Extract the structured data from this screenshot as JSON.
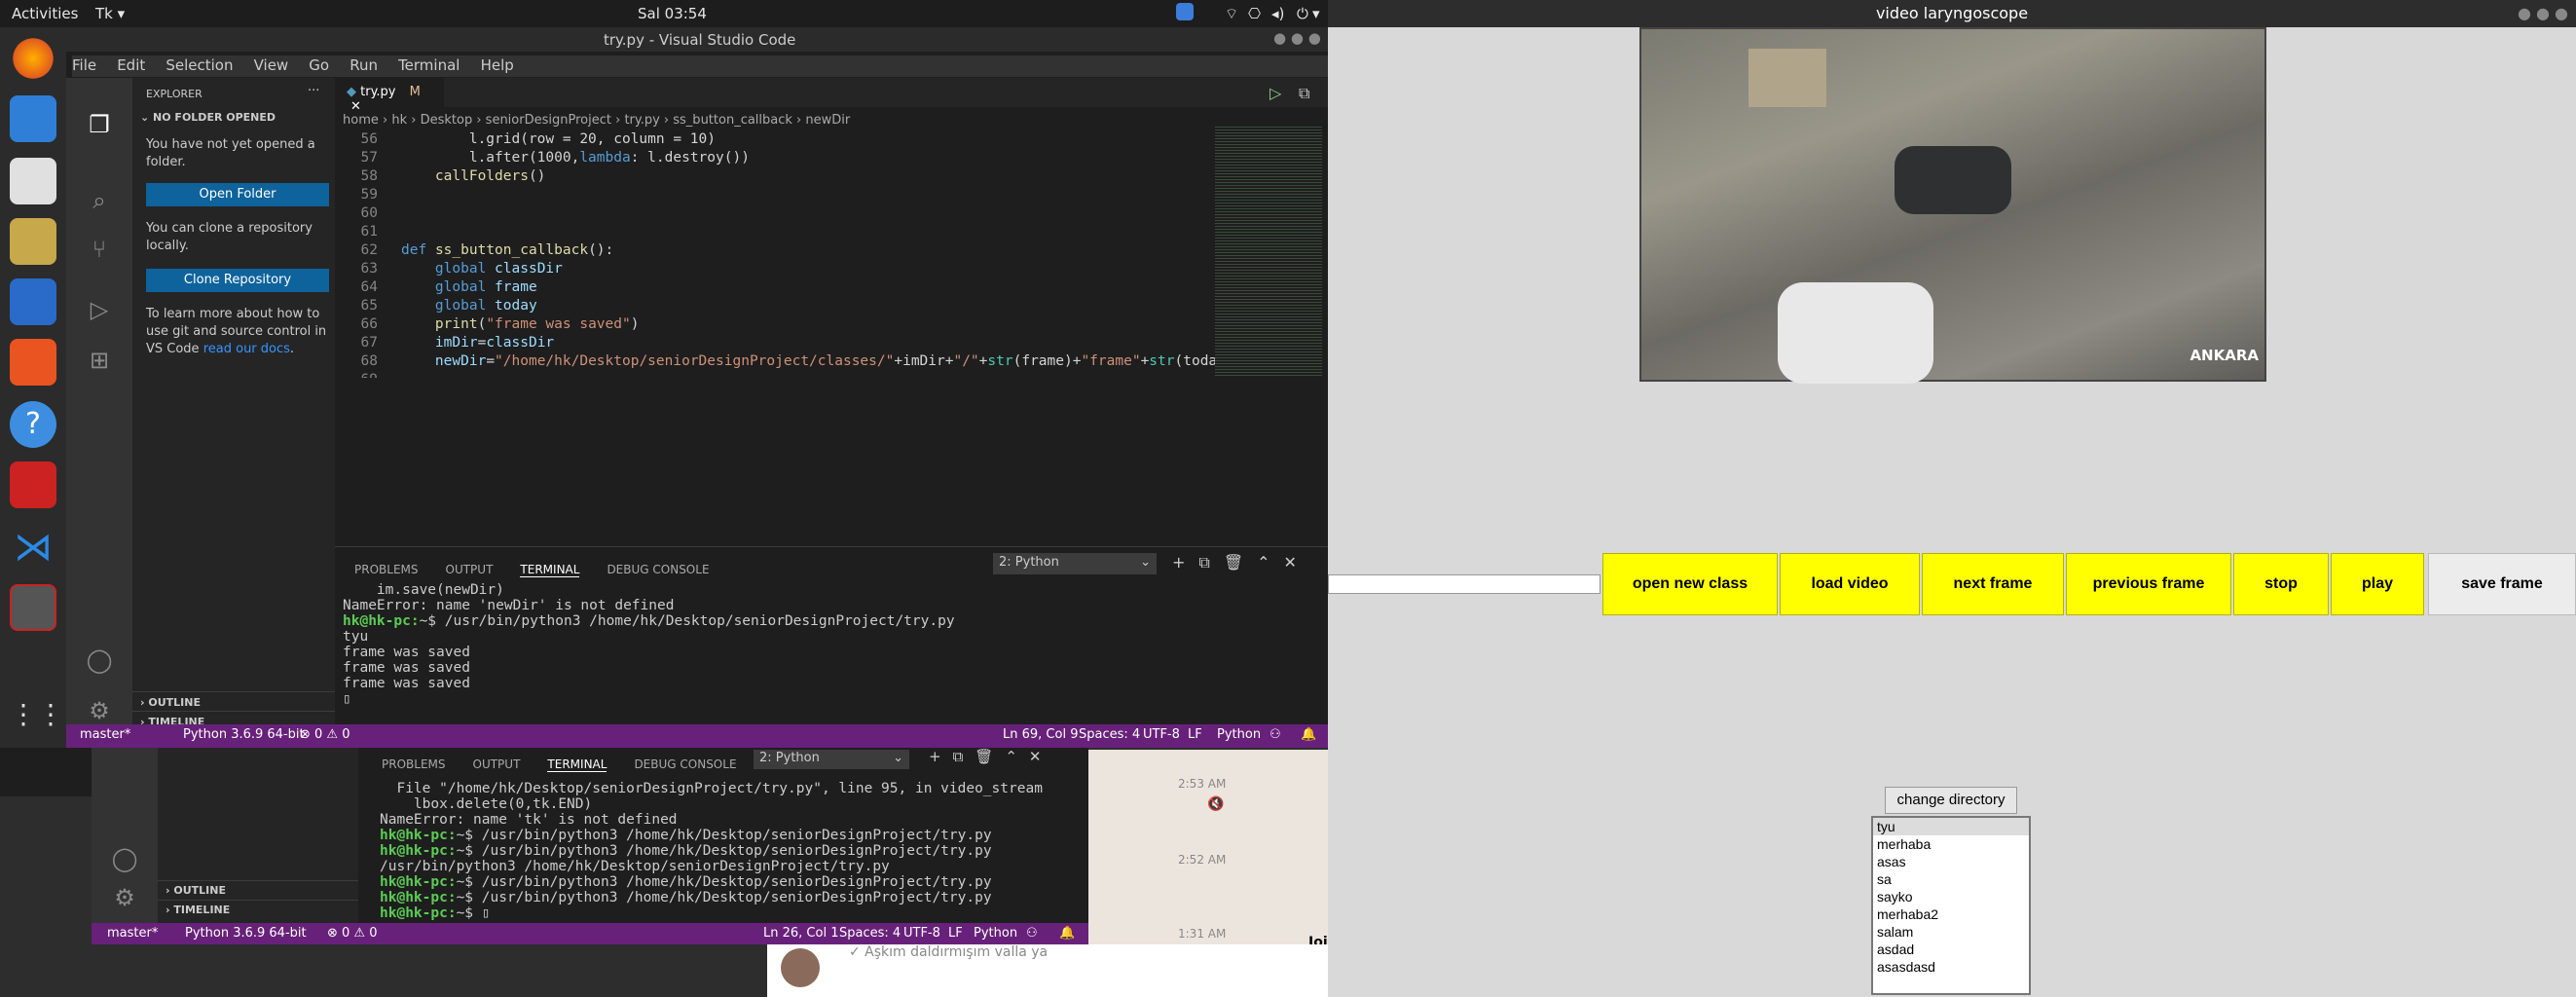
{
  "topbar": {
    "activities": "Activities",
    "app": "Tk ▾",
    "clock": "Sal 03:54"
  },
  "vscode": {
    "title": "try.py - Visual Studio Code",
    "menu": [
      "File",
      "Edit",
      "Selection",
      "View",
      "Go",
      "Run",
      "Terminal",
      "Help"
    ],
    "explorer": {
      "header": "EXPLORER",
      "section": "NO FOLDER OPENED",
      "msg1": "You have not yet opened a folder.",
      "open_btn": "Open Folder",
      "msg2": "You can clone a repository locally.",
      "clone_btn": "Clone Repository",
      "msg3": "To learn more about how to use git and source control in VS Code ",
      "link": "read our docs",
      "msg3end": ".",
      "outline": "OUTLINE",
      "timeline": "TIMELINE"
    },
    "tab": {
      "name": "try.py",
      "mod": "M"
    },
    "breadcrumb": [
      "home",
      "hk",
      "Desktop",
      "seniorDesignProject",
      "try.py",
      "ss_button_callback",
      "newDir"
    ],
    "panel_tabs": [
      "PROBLEMS",
      "OUTPUT",
      "TERMINAL",
      "DEBUG CONSOLE"
    ],
    "terminal_select": "2: Python",
    "terminal": {
      "l1": "    im.save(newDir)",
      "l2": "NameError: name 'newDir' is not defined",
      "p1": "hk@hk-pc:",
      "c1": "~$ /usr/bin/python3 /home/hk/Desktop/seniorDesignProject/try.py",
      "l3": "tyu",
      "l4": "",
      "l5": "frame was saved",
      "l6": "frame was saved",
      "l7": "frame was saved"
    },
    "status": {
      "branch": "master*",
      "python": "Python 3.6.9 64-bit",
      "errors": "⊗ 0 ⚠ 0",
      "pos": "Ln 69, Col 9",
      "spaces": "Spaces: 4",
      "enc": "UTF-8",
      "eol": "LF",
      "lang": "Python"
    }
  },
  "vscode2": {
    "panel_tabs": [
      "PROBLEMS",
      "OUTPUT",
      "TERMINAL",
      "DEBUG CONSOLE"
    ],
    "terminal_select": "2: Python",
    "terminal": {
      "l1": "  File \"/home/hk/Desktop/seniorDesignProject/try.py\", line 95, in video_stream",
      "l2": "    lbox.delete(0,tk.END)",
      "l3": "NameError: name 'tk' is not defined",
      "p": "hk@hk-pc:",
      "c1": "~$ /usr/bin/python3 /home/hk/Desktop/seniorDesignProject/try.py",
      "c2": "~$ /usr/bin/python3 /home/hk/Desktop/seniorDesignProject/try.py",
      "l4": "/usr/bin/python3 /home/hk/Desktop/seniorDesignProject/try.py",
      "c3": "~$ /usr/bin/python3 /home/hk/Desktop/seniorDesignProject/try.py",
      "c4": "~$ /usr/bin/python3 /home/hk/Desktop/seniorDesignProject/try.py",
      "c5": "~$ "
    },
    "outline": "OUTLINE",
    "timeline": "TIMELINE",
    "status": {
      "branch": "master*",
      "python": "Python 3.6.9 64-bit",
      "errors": "⊗ 0 ⚠ 0",
      "pos": "Ln 26, Col 1",
      "spaces": "Spaces: 4",
      "enc": "UTF-8",
      "eol": "LF",
      "lang": "Python"
    }
  },
  "chat": {
    "t1": "2:53 AM",
    "t2": "2:52 AM",
    "t3": "1:31 AM",
    "msg": "✓ Aşkım daldırmışım valla ya",
    "join": "Joi"
  },
  "tk": {
    "title": "video laryngoscope",
    "watermark": "ANKARA",
    "buttons": [
      "open new class",
      "load video",
      "next frame",
      "previous frame",
      "stop",
      "play",
      "save frame"
    ],
    "change_dir": "change directory",
    "list": [
      "tyu",
      "merhaba",
      "asas",
      "sa",
      "sayko",
      "merhaba2",
      "salam",
      "asdad",
      "asasdasd",
      ""
    ]
  }
}
